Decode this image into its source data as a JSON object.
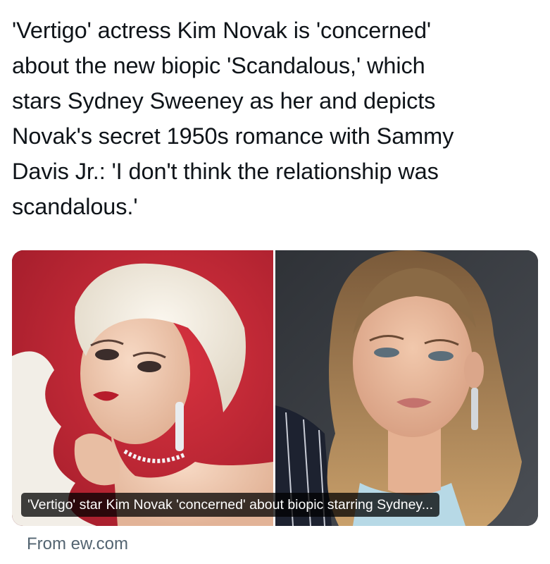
{
  "tweet": {
    "text": "'Vertigo' actress Kim Novak is 'concerned'\nabout the new biopic 'Scandalous,' which\nstars Sydney Sweeney as her and depicts\nNovak's secret 1950s romance with Sammy\nDavis Jr.: 'I don't think the relationship was\nscandalous.'"
  },
  "link_card": {
    "caption": "'Vertigo' star Kim Novak 'concerned' about biopic starring Sydney...",
    "source": "From ew.com",
    "images": [
      {
        "name": "kim-novak-photo",
        "background": "#c8283a"
      },
      {
        "name": "sydney-sweeney-photo",
        "background": "#3a3d42"
      }
    ]
  },
  "colors": {
    "text": "#0f1419",
    "secondary_text": "#536471",
    "caption_bg": "rgba(0,0,0,0.75)"
  }
}
